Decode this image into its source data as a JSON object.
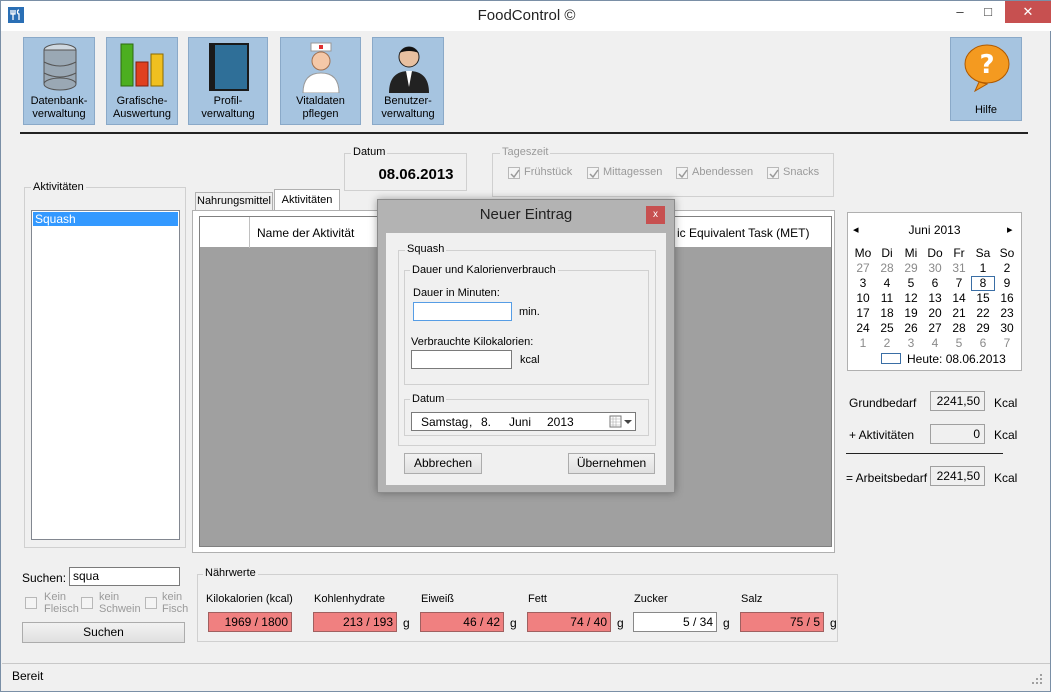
{
  "window": {
    "title": "FoodControl ©",
    "minimize": "–",
    "maximize": "□",
    "close": "✕"
  },
  "toolbar": [
    {
      "name": "datenbank",
      "line1": "Datenbank-",
      "line2": "verwaltung",
      "icon": "database-icon"
    },
    {
      "name": "grafische",
      "line1": "Grafische-",
      "line2": "Auswertung",
      "icon": "bar-chart-icon"
    },
    {
      "name": "profil",
      "line1": "Profil-",
      "line2": "verwaltung",
      "icon": "book-icon"
    },
    {
      "name": "vitaldaten",
      "line1": "Vitaldaten",
      "line2": "pflegen",
      "icon": "doctor-icon"
    },
    {
      "name": "benutzer",
      "line1": "Benutzer-",
      "line2": "verwaltung",
      "icon": "user-icon"
    }
  ],
  "help": {
    "label": "Hilfe"
  },
  "aktivitaeten_group": {
    "title": "Aktivitäten",
    "items": [
      "Squash"
    ]
  },
  "datum": {
    "title": "Datum",
    "value": "08.06.2013"
  },
  "tageszeit": {
    "title": "Tageszeit",
    "items": [
      "Frühstück",
      "Mittagessen",
      "Abendessen",
      "Snacks"
    ]
  },
  "tabs": [
    "Nahrungsmittel",
    "Aktivitäten"
  ],
  "grid": {
    "col1": "Name der Aktivität",
    "col2": "ic Equivalent Task (MET)"
  },
  "dialog": {
    "title": "Neuer Eintrag",
    "group": "Squash",
    "subgroup": "Dauer und Kalorienverbrauch",
    "dauer_label": "Dauer in Minuten:",
    "dauer_value": "",
    "dauer_unit": "min.",
    "kcal_label": "Verbrauchte Kilokalorien:",
    "kcal_value": "",
    "kcal_unit": "kcal",
    "datum_title": "Datum",
    "date_day": "Samstag",
    "date_sep": ",",
    "date_dd": "8.",
    "date_month": "Juni",
    "date_year": "2013",
    "cancel": "Abbrechen",
    "ok": "Übernehmen"
  },
  "calendar": {
    "month": "Juni 2013",
    "prev": "◂",
    "next": "▸",
    "weekdays": [
      "Mo",
      "Di",
      "Mi",
      "Do",
      "Fr",
      "Sa",
      "So"
    ],
    "rows": [
      [
        "27",
        "28",
        "29",
        "30",
        "31",
        "1",
        "2"
      ],
      [
        "3",
        "4",
        "5",
        "6",
        "7",
        "8",
        "9"
      ],
      [
        "10",
        "11",
        "12",
        "13",
        "14",
        "15",
        "16"
      ],
      [
        "17",
        "18",
        "19",
        "20",
        "21",
        "22",
        "23"
      ],
      [
        "24",
        "25",
        "26",
        "27",
        "28",
        "29",
        "30"
      ],
      [
        "1",
        "2",
        "3",
        "4",
        "5",
        "6",
        "7"
      ]
    ],
    "today_label": "Heute: 08.06.2013"
  },
  "bedarf": {
    "grund_label": "Grundbedarf",
    "grund_value": "2241,50",
    "akt_label": "+ Aktivitäten",
    "akt_value": "0",
    "arbeit_label": "= Arbeitsbedarf",
    "arbeit_value": "2241,50",
    "unit": "Kcal"
  },
  "search": {
    "label": "Suchen:",
    "value": "squa",
    "button": "Suchen",
    "filters": [
      [
        "Kein",
        "Fleisch"
      ],
      [
        "kein",
        "Schwein"
      ],
      [
        "kein",
        "Fisch"
      ]
    ]
  },
  "naehrwerte": {
    "title": "Nährwerte",
    "items": [
      {
        "label": "Kilokalorien (kcal)",
        "value": "1969 / 1800",
        "unit": "",
        "status": "over"
      },
      {
        "label": "Kohlenhydrate",
        "value": "213 / 193",
        "unit": "g",
        "status": "over"
      },
      {
        "label": "Eiweiß",
        "value": "46 / 42",
        "unit": "g",
        "status": "over"
      },
      {
        "label": "Fett",
        "value": "74 / 40",
        "unit": "g",
        "status": "over"
      },
      {
        "label": "Zucker",
        "value": "5 / 34",
        "unit": "g",
        "status": "ok"
      },
      {
        "label": "Salz",
        "value": "75 / 5",
        "unit": "g",
        "status": "over"
      }
    ]
  },
  "status": {
    "text": "Bereit"
  },
  "colors": {
    "over": "#f08080",
    "ok": "#ffffff",
    "selection": "#3399ff",
    "toolbar": "#a6c4e0"
  }
}
